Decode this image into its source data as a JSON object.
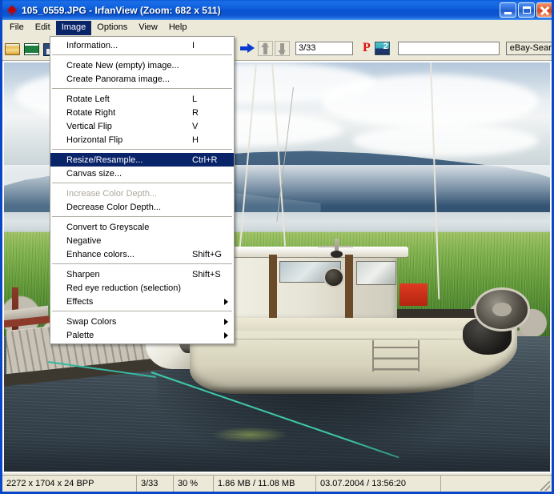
{
  "window": {
    "title": "105_0559.JPG - IrfanView (Zoom: 682 x 511)",
    "icon": "irfanview-leaf-icon",
    "minimize_label": "Minimize",
    "maximize_label": "Maximize",
    "close_label": "Close",
    "accent_titlebar": "#0a52cf",
    "accent_close": "#d4441a",
    "chrome_bg": "#ece9d8"
  },
  "menubar": {
    "items": [
      {
        "label": "File",
        "active": false
      },
      {
        "label": "Edit",
        "active": false
      },
      {
        "label": "Image",
        "active": true
      },
      {
        "label": "Options",
        "active": false
      },
      {
        "label": "View",
        "active": false
      },
      {
        "label": "Help",
        "active": false
      }
    ]
  },
  "toolbar": {
    "icons": [
      {
        "name": "open-folder-icon"
      },
      {
        "name": "thumbnails-film-icon"
      },
      {
        "name": "save-icon"
      }
    ],
    "next_arrow_icon": "blue-right-arrow-icon",
    "up_icon": "up-arrow-icon",
    "down_icon": "down-arrow-icon",
    "counter_value": "3/33",
    "print_icon_label": "P",
    "paint_icon": "paint-icon",
    "search_value": "",
    "ebay_button_label": "eBay-Search"
  },
  "image_menu": {
    "groups": [
      {
        "items": [
          {
            "label": "Information...",
            "accel": "I",
            "state": "normal",
            "submenu": false
          }
        ]
      },
      {
        "items": [
          {
            "label": "Create New (empty) image...",
            "accel": "",
            "state": "normal",
            "submenu": false
          },
          {
            "label": "Create Panorama image...",
            "accel": "",
            "state": "normal",
            "submenu": false
          }
        ]
      },
      {
        "items": [
          {
            "label": "Rotate Left",
            "accel": "L",
            "state": "normal",
            "submenu": false
          },
          {
            "label": "Rotate Right",
            "accel": "R",
            "state": "normal",
            "submenu": false
          },
          {
            "label": "Vertical Flip",
            "accel": "V",
            "state": "normal",
            "submenu": false
          },
          {
            "label": "Horizontal Flip",
            "accel": "H",
            "state": "normal",
            "submenu": false
          }
        ]
      },
      {
        "items": [
          {
            "label": "Resize/Resample...",
            "accel": "Ctrl+R",
            "state": "selected",
            "submenu": false
          },
          {
            "label": "Canvas size...",
            "accel": "",
            "state": "normal",
            "submenu": false
          }
        ]
      },
      {
        "items": [
          {
            "label": "Increase Color Depth...",
            "accel": "",
            "state": "disabled",
            "submenu": false
          },
          {
            "label": "Decrease Color Depth...",
            "accel": "",
            "state": "normal",
            "submenu": false
          }
        ]
      },
      {
        "items": [
          {
            "label": "Convert to Greyscale",
            "accel": "",
            "state": "normal",
            "submenu": false
          },
          {
            "label": "Negative",
            "accel": "",
            "state": "normal",
            "submenu": false
          },
          {
            "label": "Enhance colors...",
            "accel": "Shift+G",
            "state": "normal",
            "submenu": false
          }
        ]
      },
      {
        "items": [
          {
            "label": "Sharpen",
            "accel": "Shift+S",
            "state": "normal",
            "submenu": false
          },
          {
            "label": "Red eye reduction (selection)",
            "accel": "",
            "state": "normal",
            "submenu": false
          },
          {
            "label": "Effects",
            "accel": "",
            "state": "normal",
            "submenu": true
          }
        ]
      },
      {
        "items": [
          {
            "label": "Swap Colors",
            "accel": "",
            "state": "normal",
            "submenu": true
          },
          {
            "label": "Palette",
            "accel": "",
            "state": "normal",
            "submenu": true
          }
        ]
      }
    ]
  },
  "photo": {
    "description": "Sailboat moored beside a wooden dock on a calm fjord with green grass bank and blue mountains",
    "alt_name": "boat-photo"
  },
  "statusbar": {
    "dimensions": "2272 x 1704 x 24 BPP",
    "index": "3/33",
    "zoom": "30 %",
    "size": "1.86 MB / 11.08 MB",
    "datetime": "03.07.2004 / 13:56:20",
    "extra": ""
  }
}
